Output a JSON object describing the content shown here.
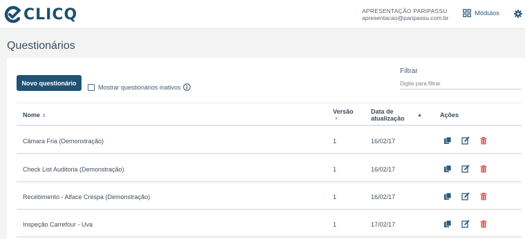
{
  "header": {
    "logo_text": "CLICQ",
    "user_name": "APRESENTAÇÃO PARIPASSU",
    "user_email": "apresentacao@paripassu.com.br",
    "modules_label": "Módulos"
  },
  "page": {
    "title": "Questionários"
  },
  "toolbar": {
    "new_button": "Novo questionário",
    "show_inactive_label": "Mostrar questionários inativos",
    "show_inactive_checked": false,
    "filter_label": "Filtrar",
    "filter_placeholder": "Digite para filtrar",
    "filter_value": ""
  },
  "table": {
    "columns": {
      "name": "Nome",
      "version": "Versão",
      "date_line1": "Data de",
      "date_line2": "atualização",
      "actions": "Ações"
    },
    "rows": [
      {
        "name": "Câmara Fria (Demonstração)",
        "version": "1",
        "date": "16/02/17"
      },
      {
        "name": "Check List Auditoria (Demonstração)",
        "version": "1",
        "date": "16/02/17"
      },
      {
        "name": "Recebimento - Alface Crespa (Demonstração)",
        "version": "1",
        "date": "16/02/17"
      },
      {
        "name": "Inspeção Carrefour - Uva",
        "version": "1",
        "date": "17/02/17"
      }
    ]
  },
  "colors": {
    "brand": "#1e4f6e",
    "primary_button": "#205274",
    "delete_icon": "#d9534f",
    "action_icon": "#2a5a7a"
  },
  "icons": [
    "clicq-logo-icon",
    "modules-grid-icon",
    "gear-icon",
    "info-icon",
    "copy-icon",
    "edit-icon",
    "trash-icon"
  ]
}
